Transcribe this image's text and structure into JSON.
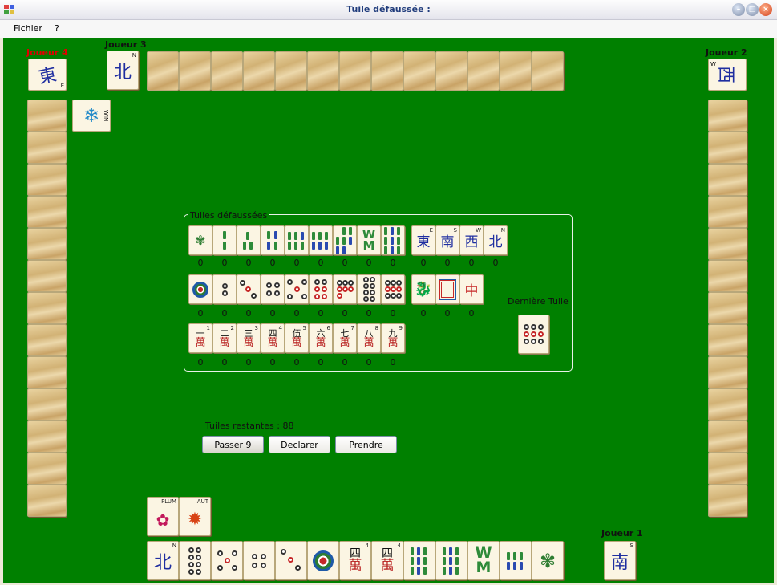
{
  "window": {
    "title": "Tuile défaussée :",
    "minimize_icon": "minimize-icon",
    "maximize_icon": "maximize-icon",
    "close_icon": "close-icon"
  },
  "menu": {
    "items": [
      "Fichier",
      "?"
    ]
  },
  "players": {
    "joueur1": {
      "label": "Joueur 1",
      "wind": "南",
      "wind_letter": "S"
    },
    "joueur2": {
      "label": "Joueur 2",
      "wind_letter": "W"
    },
    "joueur3": {
      "label": "Joueur 3",
      "wind": "北",
      "wind_letter": "N"
    },
    "joueur4": {
      "label": "Joueur 4",
      "wind": "東",
      "wind_letter": "E",
      "label_color": "#ff0000"
    }
  },
  "player4_flower": {
    "label": "WIN",
    "icon": "snowflake-icon"
  },
  "discards": {
    "title": "Tuiles défaussées",
    "row1_counts": [
      "0",
      "0",
      "0",
      "0",
      "0",
      "0",
      "0",
      "0",
      "0"
    ],
    "winds": [
      {
        "char": "東",
        "letter": "E"
      },
      {
        "char": "南",
        "letter": "S"
      },
      {
        "char": "西",
        "letter": "W"
      },
      {
        "char": "北",
        "letter": "N"
      }
    ],
    "winds_counts": [
      "0",
      "0",
      "0",
      "0"
    ],
    "row2_counts": [
      "0",
      "0",
      "0",
      "0",
      "0",
      "0",
      "0",
      "0",
      "0"
    ],
    "dragons_counts": [
      "0",
      "0",
      "0"
    ],
    "characters": [
      {
        "num": "一",
        "n": "1"
      },
      {
        "num": "二",
        "n": "2"
      },
      {
        "num": "三",
        "n": "3"
      },
      {
        "num": "四",
        "n": "4"
      },
      {
        "num": "伍",
        "n": "5"
      },
      {
        "num": "六",
        "n": "6"
      },
      {
        "num": "七",
        "n": "7"
      },
      {
        "num": "八",
        "n": "8"
      },
      {
        "num": "九",
        "n": "9"
      }
    ],
    "character_char": "萬",
    "row3_counts": [
      "0",
      "0",
      "0",
      "0",
      "0",
      "0",
      "0",
      "0",
      "0"
    ],
    "red_dragon": "中"
  },
  "derniere_tuile": {
    "label": "Dernière Tuile"
  },
  "remaining": {
    "text": "Tuiles restantes : 88"
  },
  "buttons": {
    "pass": "Passer 9",
    "declare": "Declarer",
    "take": "Prendre"
  },
  "player1_flowers": [
    {
      "label": "PLUM"
    },
    {
      "label": "AUT"
    }
  ],
  "hand": {
    "north": {
      "char": "北",
      "letter": "N"
    },
    "char4": {
      "num": "四",
      "char": "萬",
      "n": "4"
    }
  },
  "colors": {
    "table": "#008000",
    "tile_face": "#fbf5e3",
    "player4_label": "#ff0000"
  }
}
